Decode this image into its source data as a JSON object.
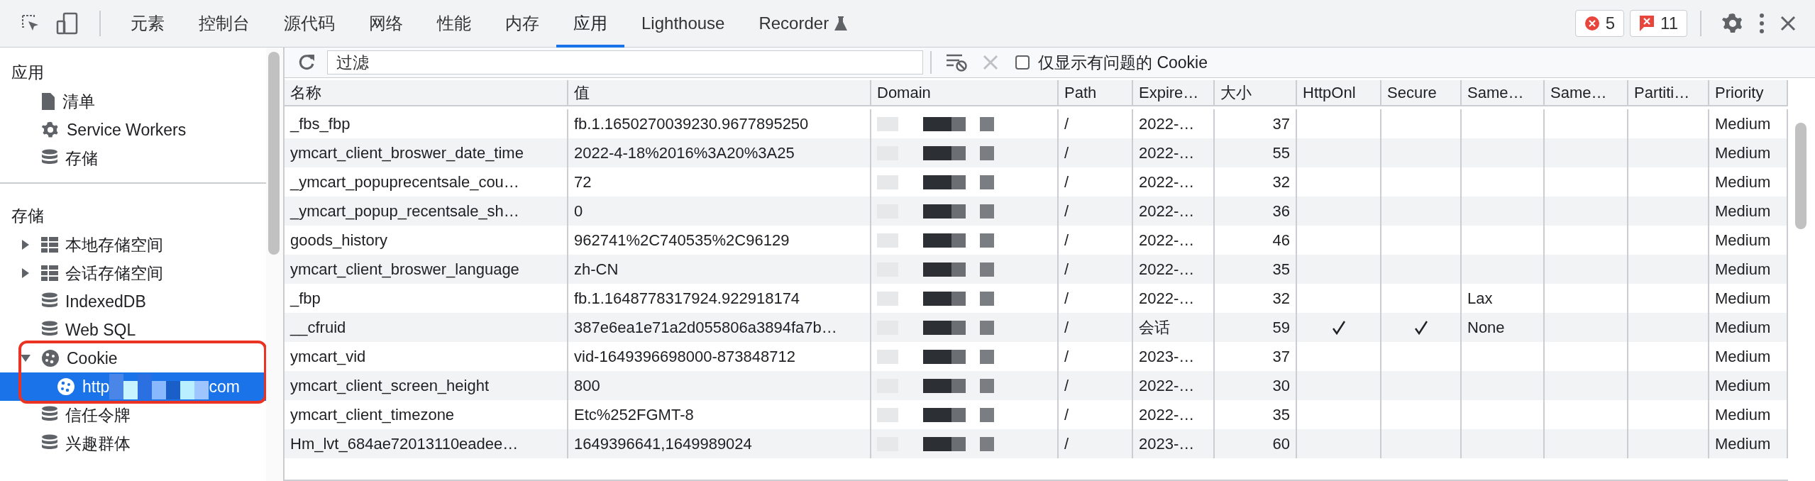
{
  "tabs": [
    {
      "label": "元素",
      "selected": false,
      "experimental": false
    },
    {
      "label": "控制台",
      "selected": false,
      "experimental": false
    },
    {
      "label": "源代码",
      "selected": false,
      "experimental": false
    },
    {
      "label": "网络",
      "selected": false,
      "experimental": false
    },
    {
      "label": "性能",
      "selected": false,
      "experimental": false
    },
    {
      "label": "内存",
      "selected": false,
      "experimental": false
    },
    {
      "label": "应用",
      "selected": true,
      "experimental": false
    },
    {
      "label": "Lighthouse",
      "selected": false,
      "experimental": false
    },
    {
      "label": "Recorder",
      "selected": false,
      "experimental": true
    }
  ],
  "counters": [
    {
      "kind": "errors",
      "count": "5"
    },
    {
      "kind": "issues",
      "count": "11"
    }
  ],
  "sidebar": {
    "sections": [
      {
        "title": "应用",
        "items": [
          {
            "label": "清单",
            "kind": "file",
            "selected": false
          },
          {
            "label": "Service Workers",
            "kind": "gear",
            "selected": false
          },
          {
            "label": "存储",
            "kind": "database",
            "selected": false
          }
        ]
      },
      {
        "title": "存储",
        "items": [
          {
            "label": "本地存储空间",
            "kind": "grid",
            "selected": false,
            "expanded": false
          },
          {
            "label": "会话存储空间",
            "kind": "grid",
            "selected": false,
            "expanded": false
          },
          {
            "label": "IndexedDB",
            "kind": "database",
            "selected": false
          },
          {
            "label": "Web SQL",
            "kind": "database",
            "selected": false
          },
          {
            "label": "Cookie",
            "kind": "cookie",
            "selected": false,
            "expanded": true,
            "children": [
              {
                "label": "http",
                "label_end": "com",
                "kind": "cookie",
                "selected": true
              }
            ]
          },
          {
            "label": "信任令牌",
            "kind": "database",
            "selected": false
          },
          {
            "label": "兴趣群体",
            "kind": "database",
            "selected": false
          }
        ]
      }
    ]
  },
  "toolbar": {
    "filter": {
      "placeholder": "过滤"
    },
    "clear_disabled": true,
    "issues_only": {
      "label": "仅显示有问题的 Cookie",
      "checked": false
    }
  },
  "table": {
    "columns": [
      "名称",
      "值",
      "Domain",
      "Path",
      "Expire…",
      "大小",
      "HttpOnl",
      "Secure",
      "Same…",
      "Same…",
      "Partiti…",
      "Priority"
    ],
    "rows": [
      {
        "name": "_fbs_fbp",
        "value": "fb.1.1650270039230.9677895250",
        "path": "/",
        "expires": "2022-…",
        "size": "37",
        "http_only": false,
        "secure": false,
        "same_site": "",
        "priority": "Medium"
      },
      {
        "name": "ymcart_client_broswer_date_time",
        "value": "2022-4-18%2016%3A20%3A25",
        "path": "/",
        "expires": "2022-…",
        "size": "55",
        "http_only": false,
        "secure": false,
        "same_site": "",
        "priority": "Medium"
      },
      {
        "name": "_ymcart_popuprecentsale_cou…",
        "value": "72",
        "path": "/",
        "expires": "2022-…",
        "size": "32",
        "http_only": false,
        "secure": false,
        "same_site": "",
        "priority": "Medium"
      },
      {
        "name": "_ymcart_popup_recentsale_sh…",
        "value": "0",
        "path": "/",
        "expires": "2022-…",
        "size": "36",
        "http_only": false,
        "secure": false,
        "same_site": "",
        "priority": "Medium"
      },
      {
        "name": "goods_history",
        "value": "962741%2C740535%2C96129",
        "path": "/",
        "expires": "2022-…",
        "size": "46",
        "http_only": false,
        "secure": false,
        "same_site": "",
        "priority": "Medium"
      },
      {
        "name": "ymcart_client_broswer_language",
        "value": "zh-CN",
        "path": "/",
        "expires": "2022-…",
        "size": "35",
        "http_only": false,
        "secure": false,
        "same_site": "",
        "priority": "Medium"
      },
      {
        "name": "_fbp",
        "value": "fb.1.1648778317924.922918174",
        "path": "/",
        "expires": "2022-…",
        "size": "32",
        "http_only": false,
        "secure": false,
        "same_site": "Lax",
        "priority": "Medium"
      },
      {
        "name": "__cfruid",
        "value": "387e6ea1e71a2d055806a3894fa7b…",
        "path": "/",
        "expires": "会话",
        "size": "59",
        "http_only": true,
        "secure": true,
        "same_site": "None",
        "priority": "Medium"
      },
      {
        "name": "ymcart_vid",
        "value": "vid-1649396698000-873848712",
        "path": "/",
        "expires": "2023-…",
        "size": "37",
        "http_only": false,
        "secure": false,
        "same_site": "",
        "priority": "Medium"
      },
      {
        "name": "ymcart_client_screen_height",
        "value": "800",
        "path": "/",
        "expires": "2022-…",
        "size": "30",
        "http_only": false,
        "secure": false,
        "same_site": "",
        "priority": "Medium"
      },
      {
        "name": "ymcart_client_timezone",
        "value": "Etc%252FGMT-8",
        "path": "/",
        "expires": "2022-…",
        "size": "35",
        "http_only": false,
        "secure": false,
        "same_site": "",
        "priority": "Medium"
      },
      {
        "name": "Hm_lvt_684ae72013110eadee…",
        "value": "1649396641,1649989024",
        "path": "/",
        "expires": "2023-…",
        "size": "60",
        "http_only": false,
        "secure": false,
        "same_site": "",
        "priority": "Medium"
      }
    ]
  }
}
